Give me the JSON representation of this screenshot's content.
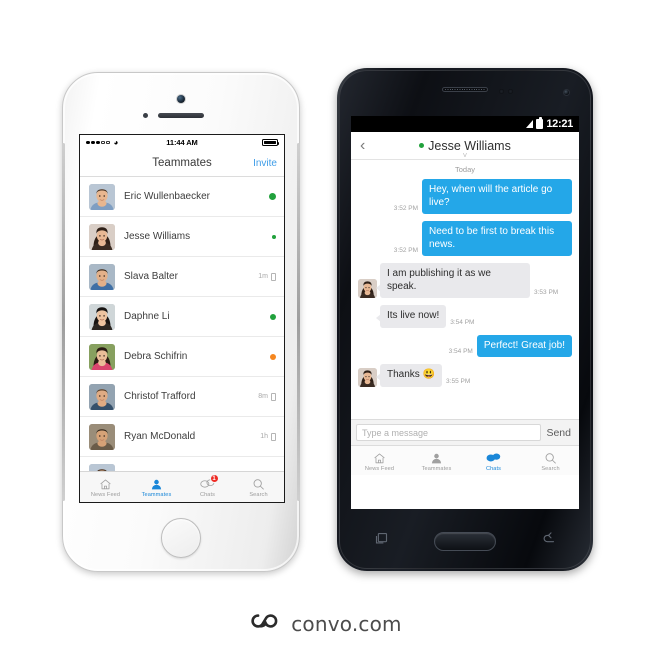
{
  "brand": {
    "logo_text": "convo.com",
    "logo_icon": "convo-infinity-logo",
    "accent_blue": "#24a7e8",
    "link_blue": "#3f9de8",
    "online_green": "#21a13c",
    "away_orange": "#f5861f",
    "badge_red": "#ee2b24"
  },
  "iphone": {
    "status_bar": {
      "carrier_dots": "signal-dots",
      "wifi_icon": "wifi-icon",
      "time": "11:44 AM",
      "battery_icon": "battery-full-icon"
    },
    "navbar": {
      "title": "Teammates",
      "invite_label": "Invite"
    },
    "teammates": [
      {
        "name": "Eric Wullenbaecker",
        "status": "online",
        "dot_size": "lg",
        "meta": "",
        "device": false,
        "avatar": "male-1"
      },
      {
        "name": "Jesse Williams",
        "status": "online",
        "dot_size": "sm",
        "meta": "",
        "device": false,
        "avatar": "female-1"
      },
      {
        "name": "Slava Balter",
        "status": "away-mobile",
        "dot_size": "",
        "meta": "1m",
        "device": true,
        "avatar": "male-2"
      },
      {
        "name": "Daphne Li",
        "status": "online",
        "dot_size": "md",
        "meta": "",
        "device": false,
        "avatar": "female-2"
      },
      {
        "name": "Debra Schifrin",
        "status": "idle",
        "dot_size": "md",
        "meta": "",
        "device": false,
        "avatar": "female-3"
      },
      {
        "name": "Christof Trafford",
        "status": "away-mobile",
        "dot_size": "",
        "meta": "8m",
        "device": true,
        "avatar": "male-3"
      },
      {
        "name": "Ryan McDonald",
        "status": "away-mobile",
        "dot_size": "",
        "meta": "1h",
        "device": true,
        "avatar": "male-4"
      }
    ],
    "tabs": [
      {
        "label": "News Feed",
        "icon": "home-icon",
        "active": false,
        "badge": ""
      },
      {
        "label": "Teammates",
        "icon": "person-icon",
        "active": true,
        "badge": ""
      },
      {
        "label": "Chats",
        "icon": "chat-bubbles-icon",
        "active": false,
        "badge": "1"
      },
      {
        "label": "Search",
        "icon": "search-icon",
        "active": false,
        "badge": ""
      }
    ]
  },
  "android": {
    "status_bar": {
      "signal_icon": "signal-bars-icon",
      "battery_icon": "battery-icon",
      "time": "12:21"
    },
    "navbar": {
      "back_icon": "chevron-left-icon",
      "presence_dot": "online",
      "title": "Jesse Williams",
      "expand_icon": "chevron-down-icon"
    },
    "day_separator": "Today",
    "messages": [
      {
        "dir": "out",
        "text": "Hey, when will the article go live?",
        "time": "3:52 PM",
        "avatar": ""
      },
      {
        "dir": "out",
        "text": "Need to be first to break this news.",
        "time": "3:52 PM",
        "avatar": ""
      },
      {
        "dir": "in",
        "text": "I am publishing it as we speak.",
        "time": "3:53 PM",
        "avatar": "female-1"
      },
      {
        "dir": "in",
        "text": "Its live now!",
        "time": "3:54 PM",
        "avatar": ""
      },
      {
        "dir": "out",
        "text": "Perfect! Great job!",
        "time": "3:54 PM",
        "avatar": ""
      },
      {
        "dir": "in",
        "text": "Thanks 😃",
        "time": "3:55 PM",
        "avatar": "female-1"
      }
    ],
    "compose": {
      "placeholder": "Type a message",
      "value": "",
      "send_label": "Send"
    },
    "tabs": [
      {
        "label": "News Feed",
        "icon": "home-icon",
        "active": false,
        "badge": ""
      },
      {
        "label": "Teammates",
        "icon": "person-icon",
        "active": false,
        "badge": ""
      },
      {
        "label": "Chats",
        "icon": "chat-bubbles-icon",
        "active": true,
        "badge": ""
      },
      {
        "label": "Search",
        "icon": "search-icon",
        "active": false,
        "badge": ""
      }
    ],
    "hardware_nav": [
      {
        "name": "recents-button",
        "icon": "recents-icon"
      },
      {
        "name": "home-button",
        "icon": "home-pill-icon"
      },
      {
        "name": "back-button",
        "icon": "back-arrow-icon"
      }
    ]
  }
}
